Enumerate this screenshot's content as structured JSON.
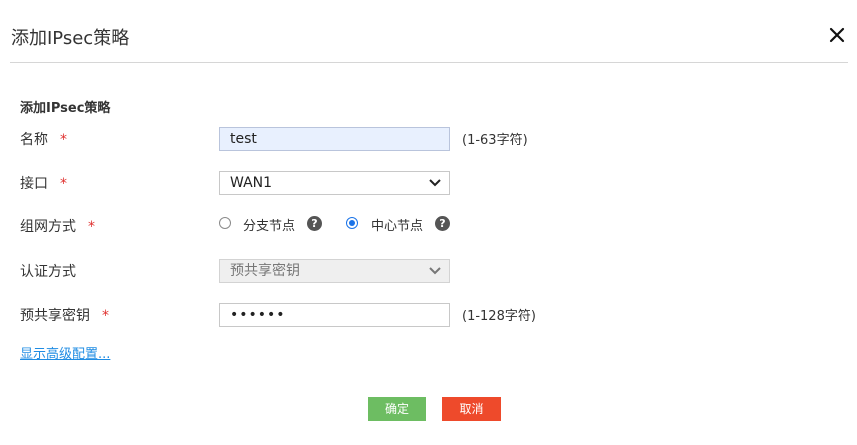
{
  "dialog": {
    "title": "添加IPsec策略"
  },
  "section": {
    "title": "添加IPsec策略"
  },
  "form": {
    "required_mark": "*",
    "name": {
      "label": "名称",
      "value": "test",
      "hint": "(1-63字符)"
    },
    "interface": {
      "label": "接口",
      "value": "WAN1"
    },
    "network_mode": {
      "label": "组网方式",
      "options": [
        {
          "label": "分支节点",
          "selected": false
        },
        {
          "label": "中心节点",
          "selected": true
        }
      ]
    },
    "auth_method": {
      "label": "认证方式",
      "value": "预共享密钥"
    },
    "psk": {
      "label": "预共享密钥",
      "value": "••••••",
      "hint": "(1-128字符)"
    }
  },
  "advanced_link": "显示高级配置...",
  "buttons": {
    "ok": "确定",
    "cancel": "取消"
  },
  "colors": {
    "accent": "#1a73e8",
    "required": "#e0312f",
    "ok_button": "#6dbd62",
    "cancel_button": "#ee4a2b",
    "link": "#1f8ce3"
  },
  "icons": {
    "close": "close-icon",
    "help": "help-icon",
    "dropdown": "chevron-down-icon"
  }
}
